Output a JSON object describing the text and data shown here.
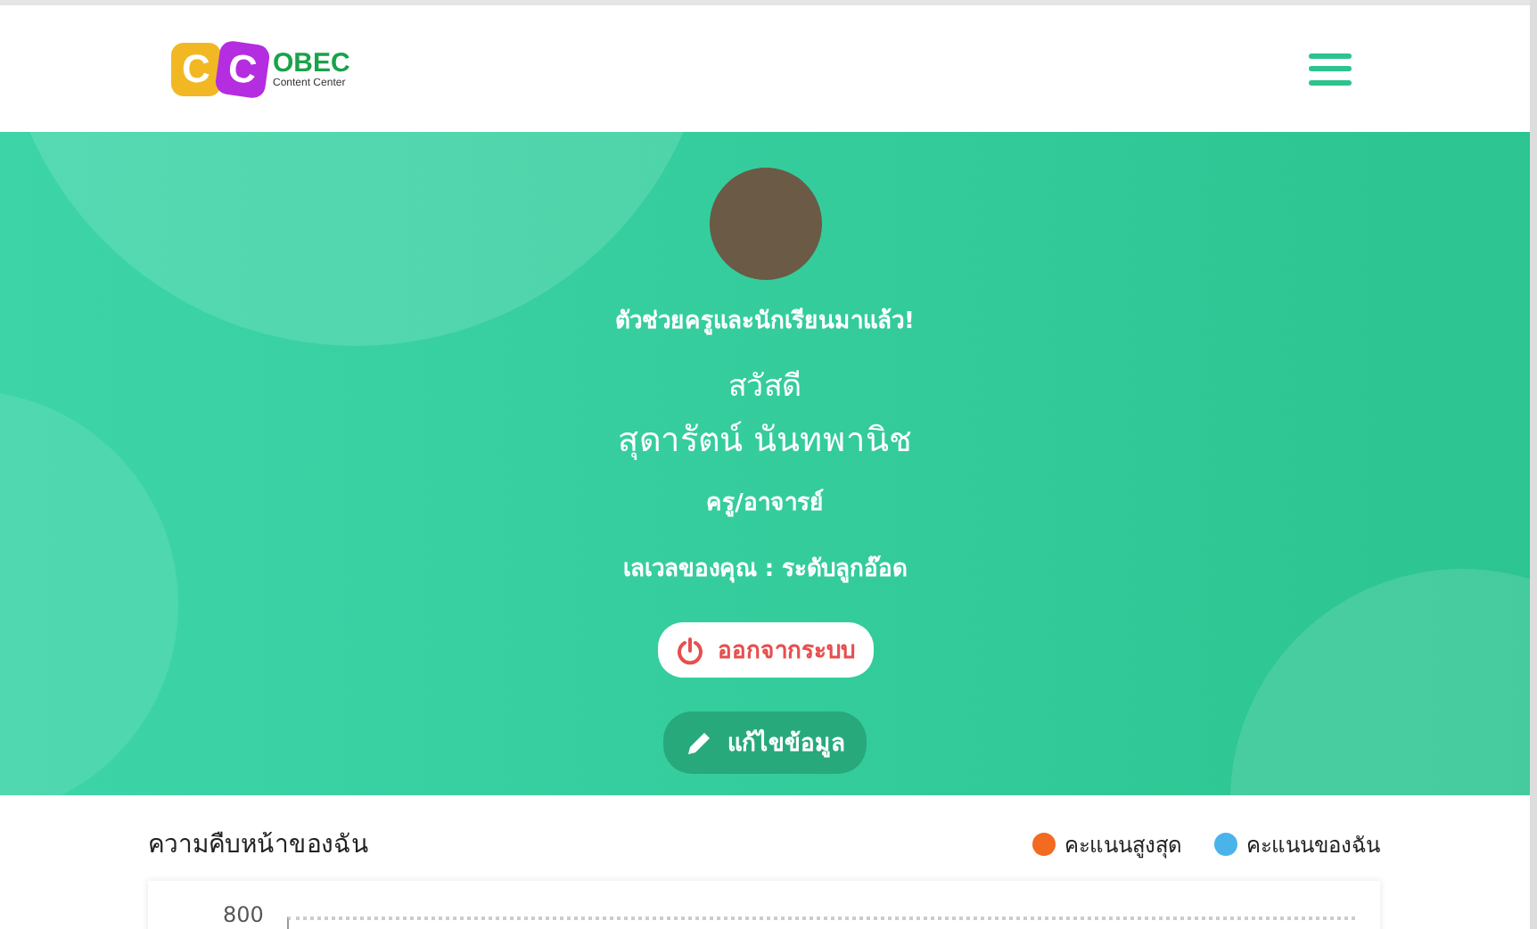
{
  "header": {
    "logo": {
      "letters": [
        "C",
        "C"
      ],
      "name": "OBEC",
      "tagline": "Content Center"
    }
  },
  "profile": {
    "tagline": "ตัวช่วยครูและนักเรียนมาแล้ว!",
    "greeting": "สวัสดี",
    "name": "สุดารัตน์ นันทพานิช",
    "role": "ครู/อาจารย์",
    "level": "เลเวลของคุณ : ระดับลูกอ๊อด",
    "logout": "ออกจากระบบ",
    "edit": "แก้ไขข้อมูล"
  },
  "progress": {
    "title": "ความคืบหน้าของฉัน",
    "legend": [
      {
        "label": "คะแนนสูงสุด",
        "color": "#f26b21"
      },
      {
        "label": "คะแนนของฉัน",
        "color": "#4ab3ea"
      }
    ],
    "y_tick": "800"
  }
}
